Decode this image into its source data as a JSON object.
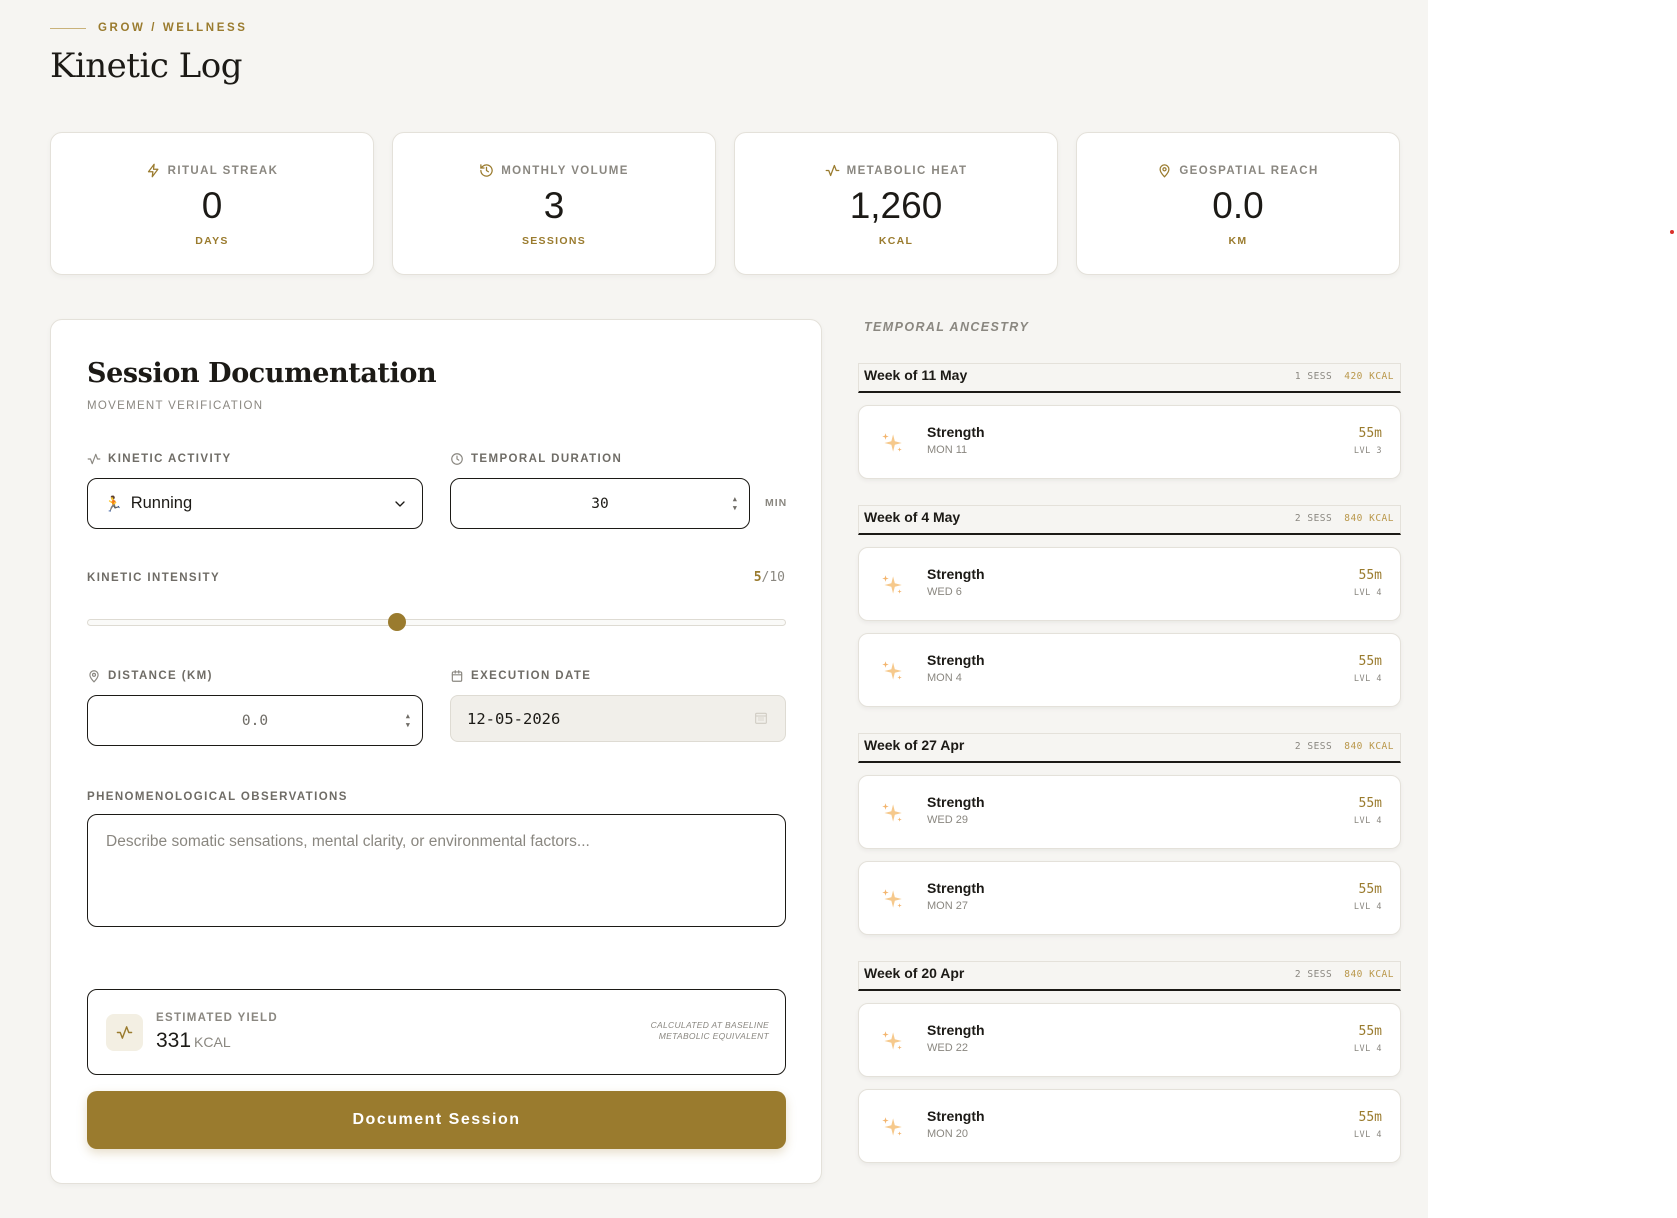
{
  "header": {
    "breadcrumb": "GROW / WELLNESS",
    "title": "Kinetic Log"
  },
  "stats": [
    {
      "label": "RITUAL STREAK",
      "value": "0",
      "unit": "DAYS",
      "icon": "bolt-icon"
    },
    {
      "label": "MONTHLY VOLUME",
      "value": "3",
      "unit": "SESSIONS",
      "icon": "history-icon"
    },
    {
      "label": "METABOLIC HEAT",
      "value": "1,260",
      "unit": "KCAL",
      "icon": "activity-icon"
    },
    {
      "label": "GEOSPATIAL REACH",
      "value": "0.0",
      "unit": "KM",
      "icon": "map-pin-icon"
    }
  ],
  "form": {
    "title": "Session Documentation",
    "subtitle": "MOVEMENT VERIFICATION",
    "activity_label": "KINETIC ACTIVITY",
    "activity_emoji": "🏃",
    "activity_value": "Running",
    "duration_label": "TEMPORAL DURATION",
    "duration_value": "30",
    "duration_unit": "MIN",
    "intensity_label": "KINETIC INTENSITY",
    "intensity_value": "5",
    "intensity_max": "/10",
    "intensity_fraction": 0.444,
    "distance_label": "DISTANCE (KM)",
    "distance_placeholder": "0.0",
    "date_label": "EXECUTION DATE",
    "date_value": "12-05-2026",
    "notes_label": "PHENOMENOLOGICAL OBSERVATIONS",
    "notes_placeholder": "Describe somatic sensations, mental clarity, or environmental factors...",
    "yield_label": "ESTIMATED YIELD",
    "yield_value": "331",
    "yield_unit": "KCAL",
    "yield_note": "CALCULATED AT BASELINE METABOLIC EQUIVALENT",
    "submit_label": "Document Session"
  },
  "history": {
    "title": "TEMPORAL ANCESTRY",
    "weeks": [
      {
        "title": "Week of 11 May",
        "sessions": "1 SESS",
        "kcal": "420 KCAL",
        "entries": [
          {
            "name": "Strength",
            "date": "MON 11",
            "duration": "55m",
            "level": "LVL 3"
          }
        ]
      },
      {
        "title": "Week of 4 May",
        "sessions": "2 SESS",
        "kcal": "840 KCAL",
        "entries": [
          {
            "name": "Strength",
            "date": "WED 6",
            "duration": "55m",
            "level": "LVL 4"
          },
          {
            "name": "Strength",
            "date": "MON 4",
            "duration": "55m",
            "level": "LVL 4"
          }
        ]
      },
      {
        "title": "Week of 27 Apr",
        "sessions": "2 SESS",
        "kcal": "840 KCAL",
        "entries": [
          {
            "name": "Strength",
            "date": "WED 29",
            "duration": "55m",
            "level": "LVL 4"
          },
          {
            "name": "Strength",
            "date": "MON 27",
            "duration": "55m",
            "level": "LVL 4"
          }
        ]
      },
      {
        "title": "Week of 20 Apr",
        "sessions": "2 SESS",
        "kcal": "840 KCAL",
        "entries": [
          {
            "name": "Strength",
            "date": "WED 22",
            "duration": "55m",
            "level": "LVL 4"
          },
          {
            "name": "Strength",
            "date": "MON 20",
            "duration": "55m",
            "level": "LVL 4"
          }
        ]
      }
    ]
  },
  "colors": {
    "accent": "#9a7b2e",
    "background": "#f6f5f2",
    "text": "#1c1a16",
    "muted": "#8a8780"
  }
}
